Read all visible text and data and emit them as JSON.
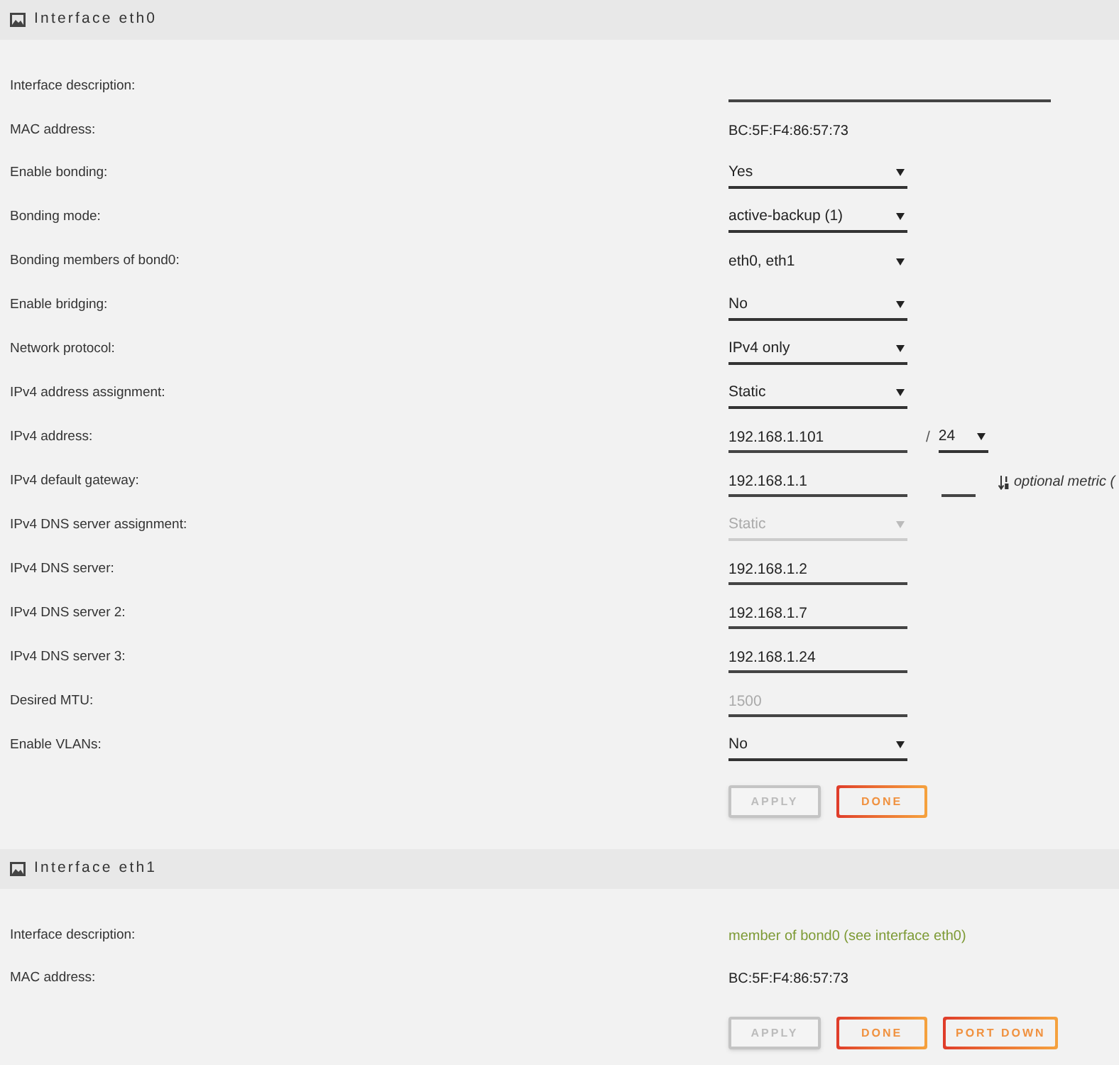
{
  "sections": [
    {
      "title": "Interface eth0",
      "rows": [
        {
          "label": "Interface description:",
          "kind": "long_input",
          "disabled": false
        },
        {
          "label": "MAC address:",
          "kind": "text",
          "value": "BC:5F:F4:86:57:73"
        },
        {
          "label": "Enable bonding:",
          "kind": "select",
          "value": "Yes",
          "disabled": false
        },
        {
          "label": "Bonding mode:",
          "kind": "select",
          "value": "active-backup (1)",
          "disabled": false
        },
        {
          "label": "Bonding members of bond0:",
          "kind": "multiselect",
          "value": "eth0, eth1",
          "disabled": false
        },
        {
          "label": "Enable bridging:",
          "kind": "select",
          "value": "No",
          "disabled": false
        },
        {
          "label": "Network protocol:",
          "kind": "select",
          "value": "IPv4 only",
          "disabled": false
        },
        {
          "label": "IPv4 address assignment:",
          "kind": "select",
          "value": "Static",
          "disabled": false
        },
        {
          "label": "IPv4 address:",
          "kind": "input",
          "value": "192.168.1.101",
          "disabled": false,
          "prefix_length": {
            "separator": "/",
            "value": "24"
          }
        },
        {
          "label": "IPv4 default gateway:",
          "kind": "input",
          "value": "192.168.1.1",
          "disabled": false,
          "metric": {
            "hint": "optional metric ("
          }
        },
        {
          "label": "IPv4 DNS server assignment:",
          "kind": "select",
          "value": "Static",
          "disabled": true
        },
        {
          "label": "IPv4 DNS server:",
          "kind": "input",
          "value": "192.168.1.2",
          "disabled": false
        },
        {
          "label": "IPv4 DNS server 2:",
          "kind": "input",
          "value": "192.168.1.7",
          "disabled": false
        },
        {
          "label": "IPv4 DNS server 3:",
          "kind": "input",
          "value": "192.168.1.24",
          "disabled": false
        },
        {
          "label": "Desired MTU:",
          "kind": "input",
          "placeholder": "1500",
          "disabled": false
        },
        {
          "label": "Enable VLANs:",
          "kind": "select",
          "value": "No",
          "disabled": false
        }
      ],
      "buttons": [
        {
          "label": "APPLY",
          "disabled": true
        },
        {
          "label": "DONE",
          "disabled": false
        }
      ]
    },
    {
      "title": "Interface eth1",
      "rows": [
        {
          "label": "Interface description:",
          "kind": "note",
          "value": "member of bond0 (see interface eth0)"
        },
        {
          "label": "MAC address:",
          "kind": "text",
          "value": "BC:5F:F4:86:57:73"
        }
      ],
      "buttons": [
        {
          "label": "APPLY",
          "disabled": true
        },
        {
          "label": "DONE",
          "disabled": false
        },
        {
          "label": "PORT DOWN",
          "disabled": false
        }
      ]
    }
  ]
}
